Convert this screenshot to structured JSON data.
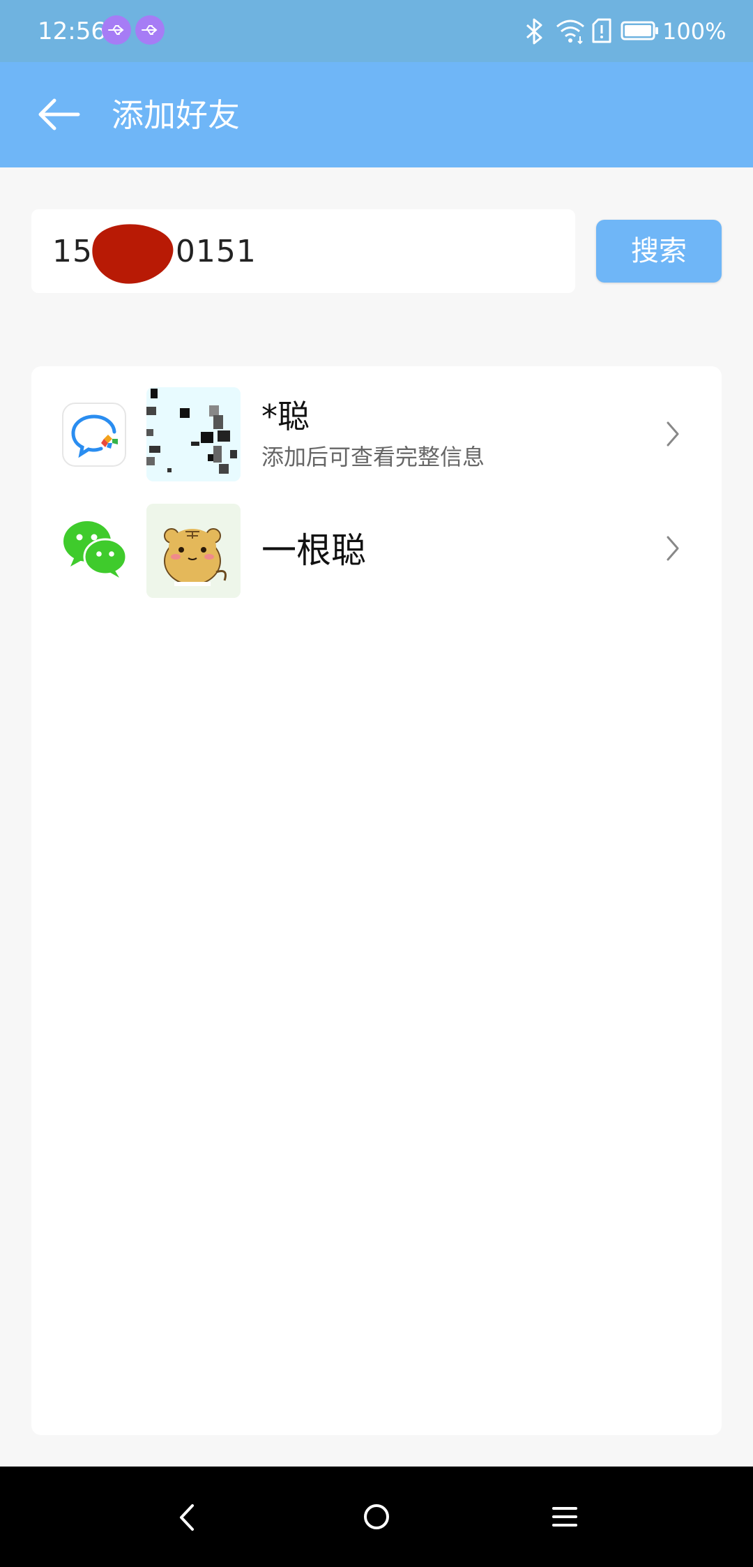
{
  "status_bar": {
    "time": "12:56",
    "battery_percent": "100%",
    "icons": [
      "usb-icon",
      "usb-icon",
      "bluetooth-icon",
      "wifi-icon",
      "sim-alert-icon",
      "battery-icon"
    ]
  },
  "app_bar": {
    "title": "添加好友",
    "back_icon": "arrow-left-icon"
  },
  "search": {
    "value": "155      0151",
    "button_label": "搜索"
  },
  "results": [
    {
      "source_icon": "chat-app-icon",
      "name": "*聪",
      "hint": "添加后可查看完整信息"
    },
    {
      "source_icon": "wechat-icon",
      "name": "一根聪",
      "hint": ""
    }
  ],
  "nav_bar": {
    "icons": [
      "nav-back-icon",
      "nav-home-icon",
      "nav-menu-icon"
    ]
  },
  "colors": {
    "status_bar": "#6fb3e0",
    "app_bar": "#6fb6f7",
    "accent": "#6fb6f7",
    "background": "#f7f7f7",
    "redaction": "#b81a05",
    "wechat_green": "#3fcb2c"
  }
}
